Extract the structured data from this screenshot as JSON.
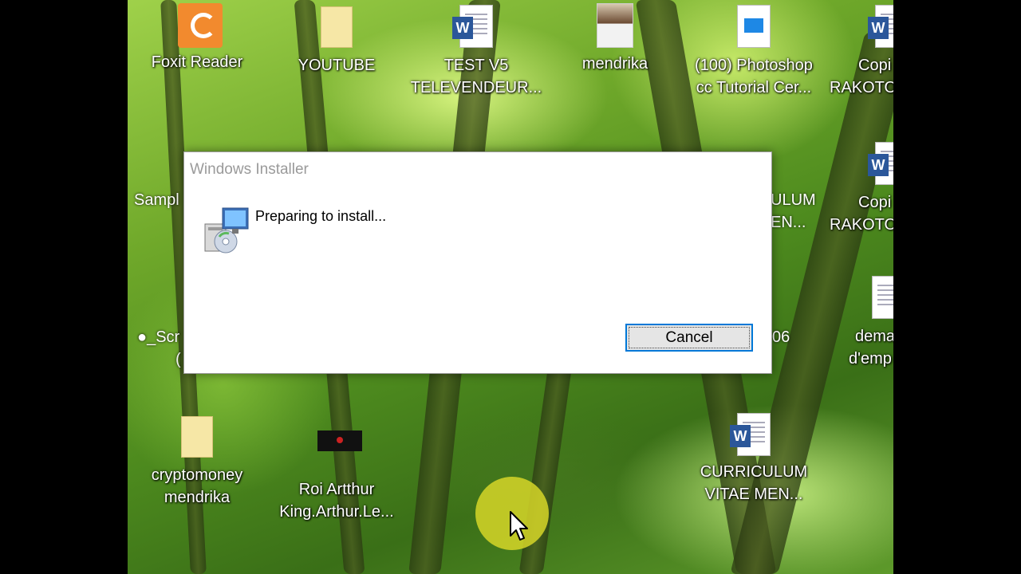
{
  "dialog": {
    "title": "Windows Installer",
    "message": "Preparing to install...",
    "cancel_label": "Cancel"
  },
  "desktop": {
    "icons": [
      {
        "label_lines": [
          "Foxit Reader"
        ],
        "icon": "foxit-pdf-icon"
      },
      {
        "label_lines": [
          "YOUTUBE"
        ],
        "icon": "folder-icon"
      },
      {
        "label_lines": [
          "TEST V5",
          "TELEVENDEUR..."
        ],
        "icon": "word-document-icon"
      },
      {
        "label_lines": [
          "mendrika"
        ],
        "icon": "photo-icon"
      },
      {
        "label_lines": [
          "(100) Photoshop",
          "cc Tutorial Cer..."
        ],
        "icon": "video-clip-icon"
      },
      {
        "label_lines": [
          "Copi",
          "RAKOTO"
        ],
        "icon": "word-document-icon"
      },
      {
        "label_lines": [
          "Copi",
          "RAKOTO"
        ],
        "icon": "word-document-icon"
      },
      {
        "label_lines": [
          "dema",
          "d'emp"
        ],
        "icon": "document-icon"
      },
      {
        "label_lines": [
          "cryptomoney",
          "mendrika"
        ],
        "icon": "folder-icon"
      },
      {
        "label_lines": [
          "Roi Artthur",
          "King.Arthur.Le..."
        ],
        "icon": "video-thumbnail-icon"
      },
      {
        "label_lines": [
          "CURRICULUM",
          "VITAE MEN..."
        ],
        "icon": "word-document-icon"
      }
    ],
    "partial_labels": [
      "Sampl",
      "●_Scr",
      "(",
      "ULUM",
      "EN...",
      "06"
    ]
  },
  "colors": {
    "accent": "#0078d7",
    "cursor_highlight": "#d6d628",
    "word_blue": "#2b579a"
  }
}
